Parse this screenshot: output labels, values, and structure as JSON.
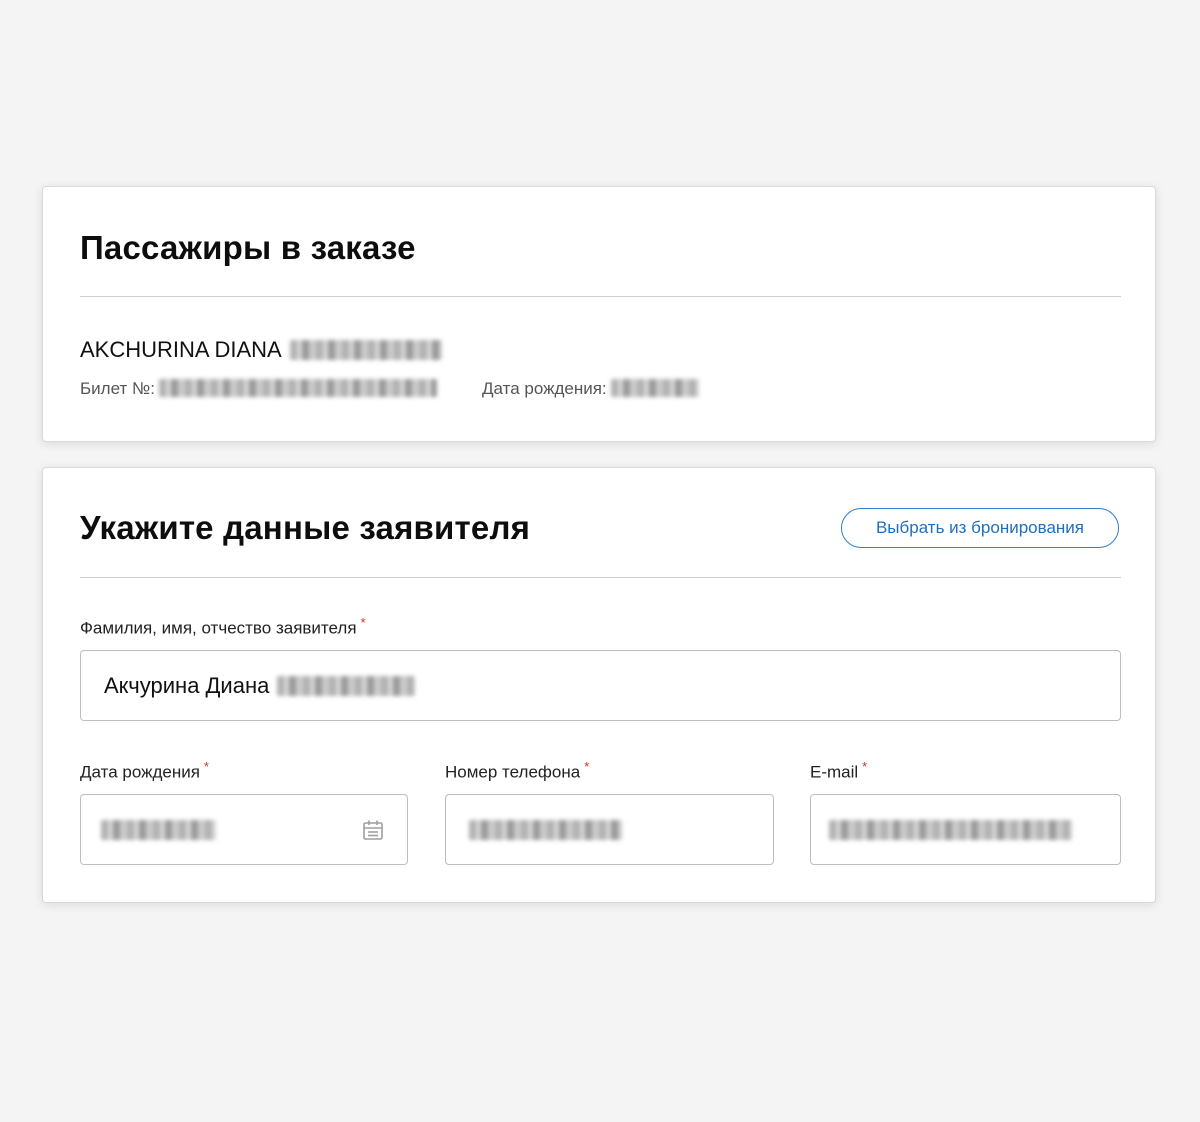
{
  "passengers": {
    "title": "Пассажиры в заказе",
    "passenger_name": "AKCHURINA DIANA",
    "ticket_label": "Билет №:",
    "birth_label": "Дата рождения:"
  },
  "applicant": {
    "title": "Укажите данные заявителя",
    "choose_button_label": "Выбрать из бронирования",
    "fio_label": "Фамилия, имя, отчество заявителя",
    "fio_value": "Акчурина Диана",
    "birth_label": "Дата рождения",
    "phone_label": "Номер телефона",
    "email_label": "E-mail",
    "required_mark": "*"
  },
  "icons": {
    "calendar": "calendar-icon"
  },
  "colors": {
    "accent": "#1f6fbf",
    "required": "#d32f2f",
    "background": "#f4f4f4"
  }
}
